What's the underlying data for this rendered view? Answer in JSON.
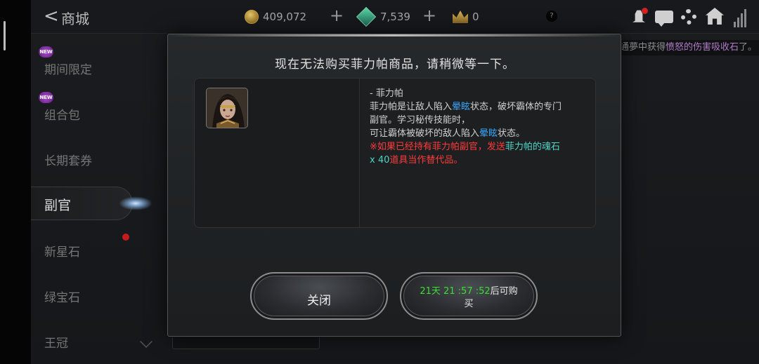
{
  "header": {
    "back_glyph": "<",
    "title": "商城",
    "gold": "409,072",
    "gem": "7,539",
    "crown": "0",
    "help": "?"
  },
  "marquee": {
    "prefix": "通夢中获得",
    "highlight": "愤怒的伤害吸收石",
    "suffix": "了。"
  },
  "sidebar": {
    "new_badge": "NEW",
    "items": [
      {
        "label": "期间限定",
        "new": true
      },
      {
        "label": "组合包",
        "new": true
      },
      {
        "label": "长期套券"
      },
      {
        "label": "副官",
        "active": true
      },
      {
        "label": "新星石",
        "dot": true
      },
      {
        "label": "绿宝石"
      },
      {
        "label": "王冠"
      }
    ]
  },
  "dialog": {
    "title": "现在无法购买菲力帕商品，请稍微等一下。",
    "desc": {
      "line1": "- 菲力帕",
      "line2_a": "菲力帕是让敌人陷入",
      "line2_b": "晕眩",
      "line2_c": "状态，破坏霸体的专门",
      "line3": "副官。学习秘传技能时，",
      "line4_a": "可让霸体被破坏的敌人陷入",
      "line4_b": "晕眩",
      "line4_c": "状态。",
      "line5_a": "※如果已经持有菲力帕副官，发送",
      "line5_b": "菲力帕的魂石",
      "line6_a": "x 40",
      "line6_b": "道具当作替代品。"
    },
    "close_label": "关闭",
    "buy_timer": "21天 21 :57 :52",
    "buy_suffix": "后可购买"
  },
  "colors": {
    "highlight_blue": "#39a9ff",
    "warning_red": "#ff3b3b",
    "item_cyan": "#4fd6c6",
    "timer_green": "#37e02f",
    "notification_red": "#d32020"
  }
}
